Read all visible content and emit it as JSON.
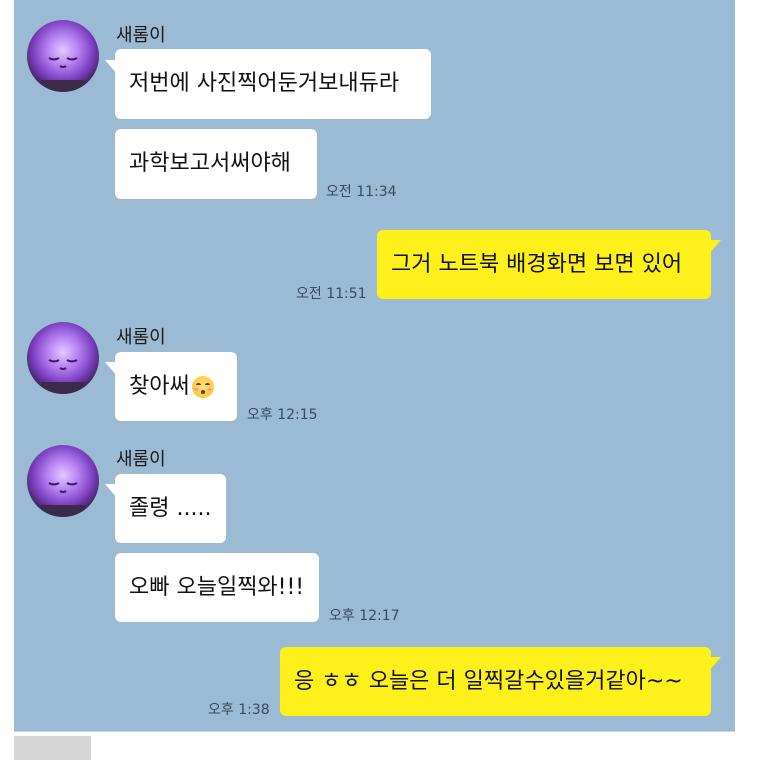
{
  "chat": {
    "messages": [
      {
        "sender": "새롬이",
        "side": "left",
        "bubbles": [
          "저번에 사진찍어둔거보내듀라",
          "과학보고서써야해"
        ],
        "time": "오전 11:34"
      },
      {
        "sender": "",
        "side": "right",
        "bubbles": [
          "그거 노트북 배경화면 보면 있어"
        ],
        "time": "오전 11:51"
      },
      {
        "sender": "새롬이",
        "side": "left",
        "bubbles": [
          "찾아써"
        ],
        "time": "오후 12:15"
      },
      {
        "sender": "새롬이",
        "side": "left",
        "bubbles": [
          "졸령 .....",
          "오빠 오늘일찍와!!!"
        ],
        "time": "오후 12:17"
      },
      {
        "sender": "",
        "side": "right",
        "bubbles": [
          "응 ㅎㅎ 오늘은 더 일찍갈수있을거같아~~"
        ],
        "time": "오후 1:38"
      }
    ]
  },
  "icons": {
    "emoji_in_message_3": "kissing-face-closed-eyes-icon",
    "avatar": "purple-face-avatar"
  },
  "colors": {
    "chat_background": "#9bbbd4",
    "my_bubble": "#fef01b",
    "their_bubble": "#ffffff"
  }
}
